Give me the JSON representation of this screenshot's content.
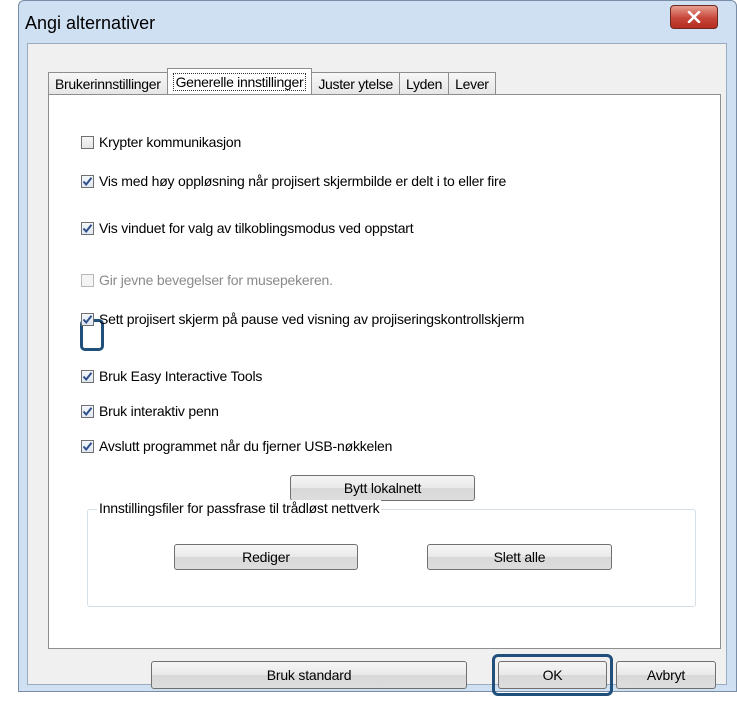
{
  "window": {
    "title": "Angi alternativer",
    "close_glyph": "X"
  },
  "tabs": [
    {
      "label": "Brukerinnstillinger",
      "active": false
    },
    {
      "label": "Generelle innstillinger",
      "active": true
    },
    {
      "label": "Juster ytelse",
      "active": false
    },
    {
      "label": "Lyden",
      "active": false
    },
    {
      "label": "Lever",
      "active": false
    }
  ],
  "options": [
    {
      "label": "Krypter kommunikasjon",
      "checked": false,
      "enabled": true
    },
    {
      "label": "Vis med høy oppløsning når projisert skjermbilde er delt i to eller fire",
      "checked": true,
      "enabled": true
    },
    {
      "label": "Vis vinduet for valg av tilkoblingsmodus ved oppstart",
      "checked": true,
      "enabled": true
    },
    {
      "label": "Gir jevne bevegelser for musepekeren.",
      "checked": false,
      "enabled": false
    },
    {
      "label": "Sett projisert skjerm på pause ved visning av projiseringskontrollskjerm",
      "checked": true,
      "enabled": true,
      "highlighted": true
    },
    {
      "label": "Bruk Easy Interactive Tools",
      "checked": true,
      "enabled": true
    },
    {
      "label": "Bruk interaktiv penn",
      "checked": true,
      "enabled": true
    },
    {
      "label": "Avslutt programmet når du fjerner USB-nøkkelen",
      "checked": true,
      "enabled": true
    }
  ],
  "buttons": {
    "switch_lan": "Bytt lokalnett",
    "edit": "Rediger",
    "delete_all": "Slett alle",
    "use_default": "Bruk standard",
    "ok": "OK",
    "cancel": "Avbryt"
  },
  "group": {
    "title": "Innstillingsfiler for passfrase til trådløst nettverk"
  },
  "colors": {
    "highlight": "#1f4f7a",
    "window_frame": "#cfe0f3",
    "close_button": "#c6463a"
  }
}
